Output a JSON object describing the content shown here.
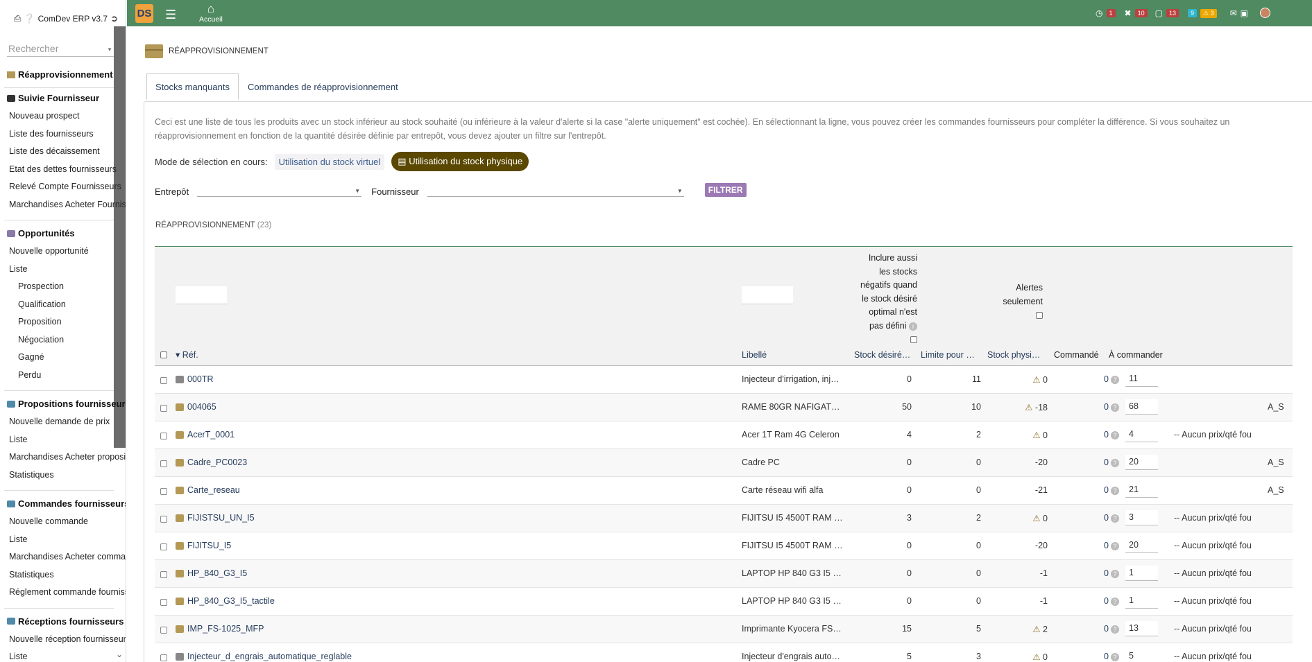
{
  "app": {
    "title": "ComDev ERP v3.7",
    "search_placeholder": "Rechercher",
    "home_label": "Accueil"
  },
  "topbar_badges": [
    {
      "icon": "clock-icon",
      "value": "1",
      "color": "#bd3f3f"
    },
    {
      "icon": "tools-icon",
      "value": "10",
      "color": "#bd3f3f"
    },
    {
      "icon": "calendar-icon",
      "value": "13",
      "color": "#bd3f3f"
    },
    {
      "icon": "info-icon",
      "value": "9",
      "color": "#30b6cf"
    },
    {
      "icon": "warning-icon",
      "value": "3",
      "color": "#eba800"
    }
  ],
  "sidebar": {
    "module": "Réapprovisionnement",
    "sections": [
      {
        "title": "Suivie Fournisseur",
        "items": [
          "Nouveau prospect",
          "Liste des fournisseurs",
          "Liste des décaissement",
          "Etat des dettes fournisseurs",
          "Relevé Compte Fournisseurs",
          "Marchandises Acheter Fournisseur"
        ]
      },
      {
        "title": "Opportunités",
        "items": [
          "Nouvelle opportunité",
          "Liste"
        ],
        "subitems": [
          "Prospection",
          "Qualification",
          "Proposition",
          "Négociation",
          "Gagné",
          "Perdu"
        ]
      },
      {
        "title": "Propositions fournisseurs",
        "items": [
          "Nouvelle demande de prix",
          "Liste",
          "Marchandises Acheter propositions",
          "Statistiques"
        ]
      },
      {
        "title": "Commandes fournisseurs",
        "items": [
          "Nouvelle commande",
          "Liste",
          "Marchandises Acheter commandes",
          "Statistiques",
          "Réglement commande fournisseur"
        ]
      },
      {
        "title": "Réceptions fournisseurs",
        "items": [
          "Nouvelle réception fournisseur",
          "Liste"
        ]
      }
    ]
  },
  "page": {
    "title": "RÉAPPROVISIONNEMENT",
    "tabs": [
      "Stocks manquants",
      "Commandes de réapprovisionnement"
    ],
    "description": "Ceci est une liste de tous les produits avec un stock inférieur au stock souhaité (ou inférieure à la valeur d'alerte si la case \"alerte uniquement\" est cochée). En sélectionnant la ligne, vous pouvez créer les commandes fournisseurs pour compléter la différence. Si vous souhaitez un réapprovisionnement en fonction de la quantité désirée définie par entrepôt, vous devez ajouter un filtre sur l'entrepôt.",
    "mode_label": "Mode de sélection en cours:",
    "mode_virtual": "Utilisation du stock virtuel",
    "mode_physical": "Utilisation du stock physique",
    "filter_warehouse": "Entrepôt",
    "filter_supplier": "Fournisseur",
    "filter_button": "FILTRER",
    "section_title": "RÉAPPROVISIONNEMENT",
    "section_count": "(23)",
    "include_negative_note": "Inclure aussi les stocks négatifs quand le stock désiré optimal n'est pas défini",
    "alerts_only": "Alertes seulement"
  },
  "table": {
    "headers": [
      "Réf.",
      "Libellé",
      "Stock désiré…",
      "Limite pour …",
      "Stock physi…",
      "Commandé",
      "À commander"
    ],
    "rows": [
      {
        "ref": "000TR",
        "label": "Injecteur d'irrigation, inj…",
        "desired": "0",
        "limit": "11",
        "physical": "0",
        "warn": true,
        "ordered": "0",
        "to_order": "11",
        "supplier": "",
        "svc": true
      },
      {
        "ref": "004065",
        "label": "RAME 80GR NAFIGAT…",
        "desired": "50",
        "limit": "10",
        "physical": "-18",
        "warn": true,
        "ordered": "0",
        "to_order": "68",
        "supplier": "A_S",
        "svc": false
      },
      {
        "ref": "AcerT_0001",
        "label": "Acer 1T Ram 4G Celeron",
        "desired": "4",
        "limit": "2",
        "physical": "0",
        "warn": true,
        "ordered": "0",
        "to_order": "4",
        "supplier": "-- Aucun prix/qté fou",
        "svc": false
      },
      {
        "ref": "Cadre_PC0023",
        "label": "Cadre PC",
        "desired": "0",
        "limit": "0",
        "physical": "-20",
        "warn": false,
        "ordered": "0",
        "to_order": "20",
        "supplier": "A_S",
        "svc": false
      },
      {
        "ref": "Carte_reseau",
        "label": "Carte réseau wifi alfa",
        "desired": "0",
        "limit": "0",
        "physical": "-21",
        "warn": false,
        "ordered": "0",
        "to_order": "21",
        "supplier": "A_S",
        "svc": false
      },
      {
        "ref": "FIJISTSU_UN_I5",
        "label": "FIJITSU I5 4500T RAM …",
        "desired": "3",
        "limit": "2",
        "physical": "0",
        "warn": true,
        "ordered": "0",
        "to_order": "3",
        "supplier": "-- Aucun prix/qté fou",
        "svc": false
      },
      {
        "ref": "FIJITSU_I5",
        "label": "FIJITSU I5 4500T RAM …",
        "desired": "0",
        "limit": "0",
        "physical": "-20",
        "warn": false,
        "ordered": "0",
        "to_order": "20",
        "supplier": "-- Aucun prix/qté fou",
        "svc": false
      },
      {
        "ref": "HP_840_G3_I5",
        "label": "LAPTOP HP 840 G3 I5 …",
        "desired": "0",
        "limit": "0",
        "physical": "-1",
        "warn": false,
        "ordered": "0",
        "to_order": "1",
        "supplier": "-- Aucun prix/qté fou",
        "svc": false
      },
      {
        "ref": "HP_840_G3_I5_tactile",
        "label": "LAPTOP HP 840 G3 I5 …",
        "desired": "0",
        "limit": "0",
        "physical": "-1",
        "warn": false,
        "ordered": "0",
        "to_order": "1",
        "supplier": "-- Aucun prix/qté fou",
        "svc": false
      },
      {
        "ref": "IMP_FS-1025_MFP",
        "label": "Imprimante Kyocera FS…",
        "desired": "15",
        "limit": "5",
        "physical": "2",
        "warn": true,
        "ordered": "0",
        "to_order": "13",
        "supplier": "-- Aucun prix/qté fou",
        "svc": false
      },
      {
        "ref": "Injecteur_d_engrais_automatique_reglable",
        "label": "Injecteur d'engrais auto…",
        "desired": "5",
        "limit": "3",
        "physical": "0",
        "warn": true,
        "ordered": "0",
        "to_order": "5",
        "supplier": "-- Aucun prix/qté fou",
        "svc": true
      }
    ]
  }
}
